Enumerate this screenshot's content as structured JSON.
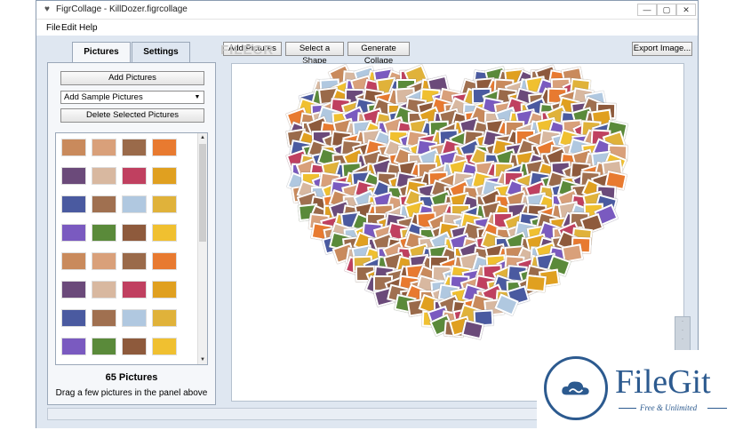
{
  "window": {
    "title": "FigrCollage - KillDozer.figrcollage",
    "controls": {
      "minimize": "—",
      "maximize": "▢",
      "close": "✕"
    }
  },
  "menu": {
    "items": [
      "File",
      "Edit",
      "Help"
    ]
  },
  "left_panel": {
    "tabs": [
      {
        "label": "Pictures",
        "active": true
      },
      {
        "label": "Settings",
        "active": false
      }
    ],
    "add_pictures_label": "Add Pictures",
    "sample_select_value": "Add Sample Pictures",
    "delete_label": "Delete Selected Pictures",
    "picture_count": "65 Pictures",
    "hint": "Drag a few pictures in the panel above"
  },
  "toolbar": {
    "add_pictures": "Add Pictures",
    "select_shape": "Select a Shape",
    "generate_collage": "Generate Collage",
    "export_image": "Export Image..."
  },
  "watermark": {
    "brand": "FILECR",
    "domain": ".com"
  },
  "badge": {
    "name": "FileGit",
    "tagline": "Free & Unlimited"
  },
  "colors": {
    "accent": "#2c5a8f",
    "panel": "#dfe7f1",
    "canvas": "#ffffff"
  }
}
